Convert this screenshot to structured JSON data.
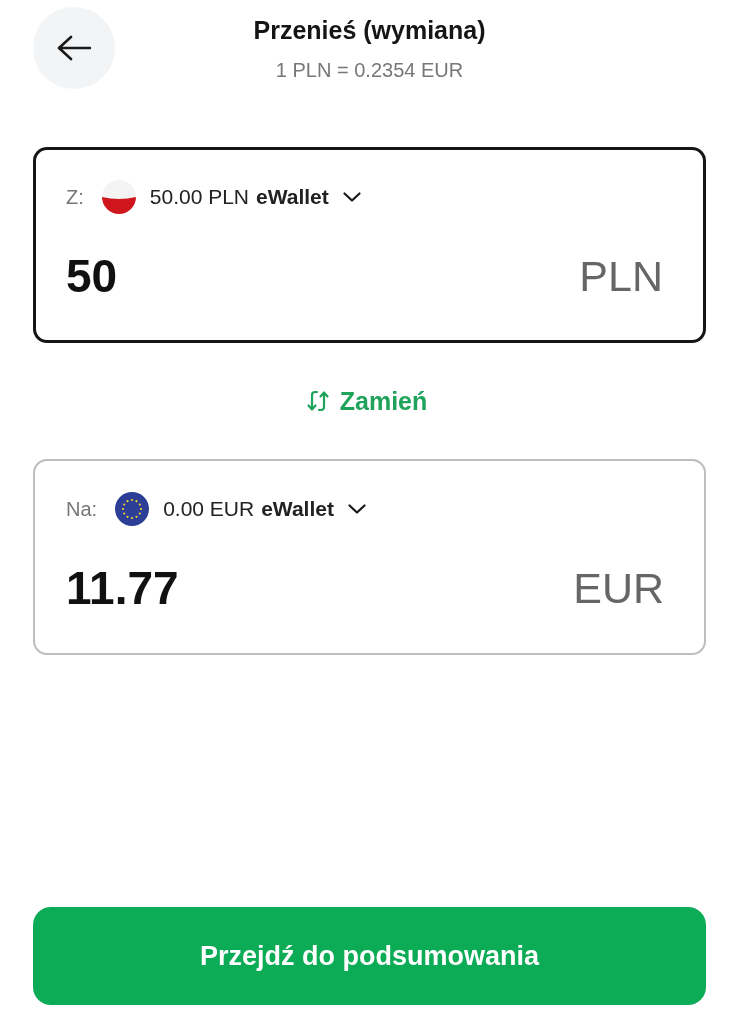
{
  "header": {
    "title": "Przenieś (wymiana)",
    "rate": "1 PLN = 0.2354 EUR"
  },
  "accounts": [
    {
      "label": "Z:",
      "kind": "pl",
      "balance": "50.00 PLN",
      "wallet": "eWallet",
      "amount": "50",
      "currency": "PLN",
      "selected": true
    },
    {
      "label": "Na:",
      "kind": "eu",
      "balance": "0.00 EUR",
      "wallet": "eWallet",
      "amount": "11.77",
      "currency": "EUR",
      "selected": false
    }
  ],
  "swap": {
    "label": "Zamień"
  },
  "continue_button": {
    "label": "Przejdź do podsumowania"
  }
}
